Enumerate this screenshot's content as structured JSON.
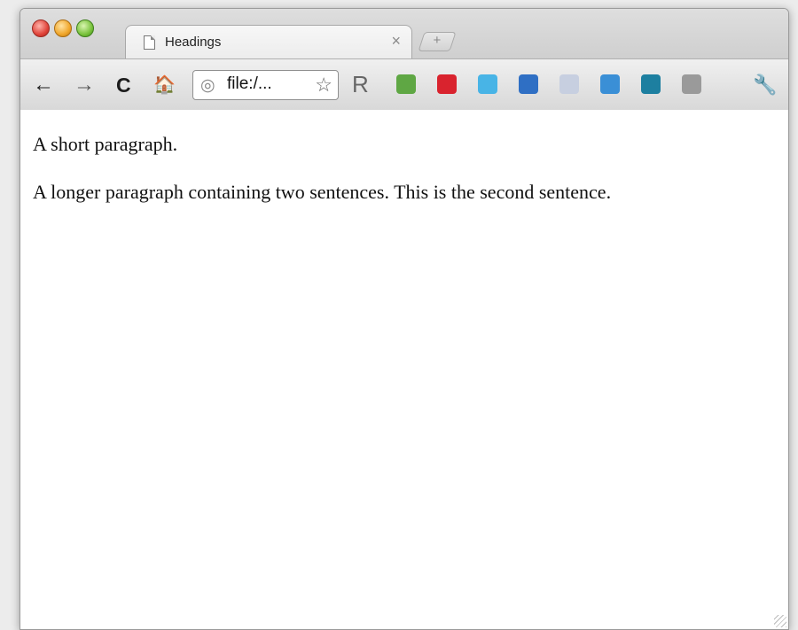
{
  "browser": {
    "tab": {
      "title": "Headings",
      "close_glyph": "×"
    },
    "new_tab_glyph": "+",
    "toolbar": {
      "back_icon": "←",
      "forward_icon": "→",
      "reload_icon": "C",
      "home_icon": "🏠",
      "address": "file:/...",
      "globe_icon": "◎",
      "star_icon": "☆",
      "wrench_icon": "🔧",
      "r_extension_label": "R"
    },
    "extensions": [
      {
        "name": "evernote-icon",
        "color": "#5fa744"
      },
      {
        "name": "magnet-icon",
        "color": "#d9232e"
      },
      {
        "name": "twitter-icon",
        "color": "#48b4e6"
      },
      {
        "name": "download-icon",
        "color": "#2f6fc4"
      },
      {
        "name": "facebook-icon",
        "color": "#c7cfe0"
      },
      {
        "name": "chat-icon",
        "color": "#3a8fd6"
      },
      {
        "name": "terminal-icon",
        "color": "#1d7fa0"
      },
      {
        "name": "settings-globe-icon",
        "color": "#9a9a9a"
      }
    ]
  },
  "page": {
    "paragraphs": [
      "A short paragraph.",
      "A longer paragraph containing two sentences. This is the second sentence."
    ]
  }
}
